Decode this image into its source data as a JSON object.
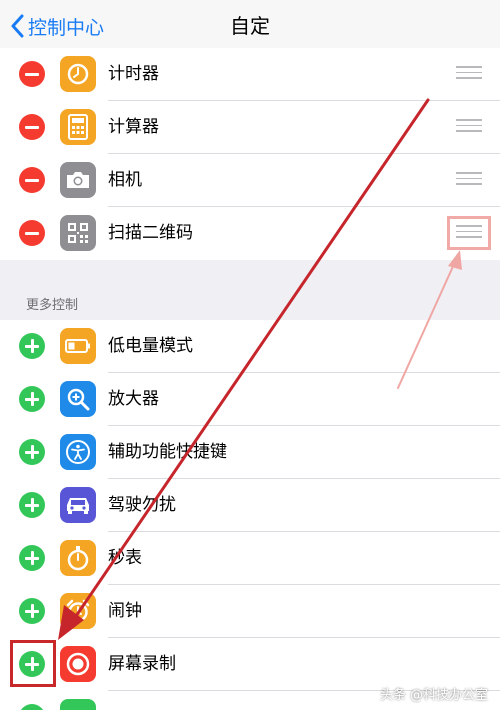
{
  "nav": {
    "back_label": "控制中心",
    "title": "自定"
  },
  "included": [
    {
      "label": "计时器",
      "icon": "timer-icon",
      "color": "#f4a523"
    },
    {
      "label": "计算器",
      "icon": "calculator-icon",
      "color": "#f4a523"
    },
    {
      "label": "相机",
      "icon": "camera-icon",
      "color": "#8e8e93"
    },
    {
      "label": "扫描二维码",
      "icon": "qr-code-icon",
      "color": "#8e8e93"
    }
  ],
  "more_header": "更多控制",
  "more": [
    {
      "label": "低电量模式",
      "icon": "battery-icon",
      "color": "#f4a523"
    },
    {
      "label": "放大器",
      "icon": "magnifier-icon",
      "color": "#1f8ae8"
    },
    {
      "label": "辅助功能快捷键",
      "icon": "accessibility-icon",
      "color": "#1f8ae8"
    },
    {
      "label": "驾驶勿扰",
      "icon": "car-icon",
      "color": "#5856d6"
    },
    {
      "label": "秒表",
      "icon": "stopwatch-icon",
      "color": "#f4a523"
    },
    {
      "label": "闹钟",
      "icon": "alarm-icon",
      "color": "#f4a523"
    },
    {
      "label": "屏幕录制",
      "icon": "screen-record-icon",
      "color": "#f53b30"
    }
  ],
  "watermark": "头条 @科技办公室"
}
